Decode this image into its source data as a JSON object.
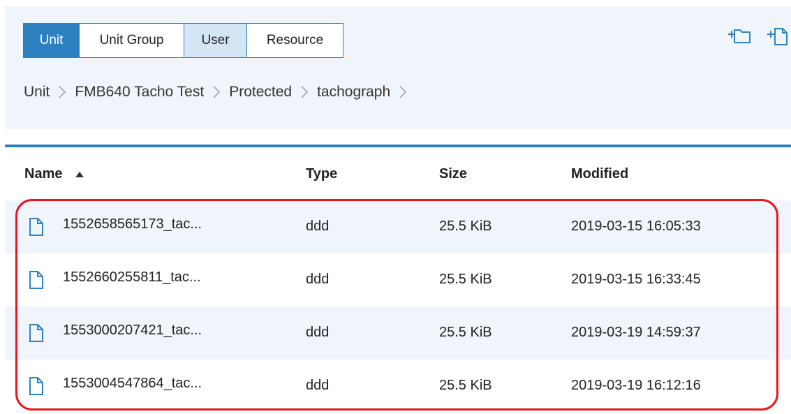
{
  "tabs": [
    {
      "label": "Unit",
      "state": "active"
    },
    {
      "label": "Unit Group",
      "state": "normal"
    },
    {
      "label": "User",
      "state": "hover"
    },
    {
      "label": "Resource",
      "state": "normal"
    }
  ],
  "header_actions": [
    {
      "icon": "add-folder-icon"
    },
    {
      "icon": "add-file-icon"
    }
  ],
  "breadcrumb": [
    "Unit",
    "FMB640 Tacho Test",
    "Protected",
    "tachograph"
  ],
  "table": {
    "columns": {
      "name": "Name",
      "type": "Type",
      "size": "Size",
      "modified": "Modified"
    },
    "sort": {
      "column": "name",
      "direction": "ascending"
    },
    "rows": [
      {
        "name": "1552658565173_tac...",
        "type": "ddd",
        "size": "25.5 KiB",
        "modified": "2019-03-15 16:05:33"
      },
      {
        "name": "1552660255811_tac...",
        "type": "ddd",
        "size": "25.5 KiB",
        "modified": "2019-03-15 16:33:45"
      },
      {
        "name": "1553000207421_tac...",
        "type": "ddd",
        "size": "25.5 KiB",
        "modified": "2019-03-19 14:59:37"
      },
      {
        "name": "1553004547864_tac...",
        "type": "ddd",
        "size": "25.5 KiB",
        "modified": "2019-03-19 16:12:16"
      }
    ]
  },
  "colors": {
    "accent": "#2d81c1",
    "panel_bg": "#eff5fa",
    "hover_bg": "#d4e6f6",
    "highlight": "#e8141f"
  }
}
